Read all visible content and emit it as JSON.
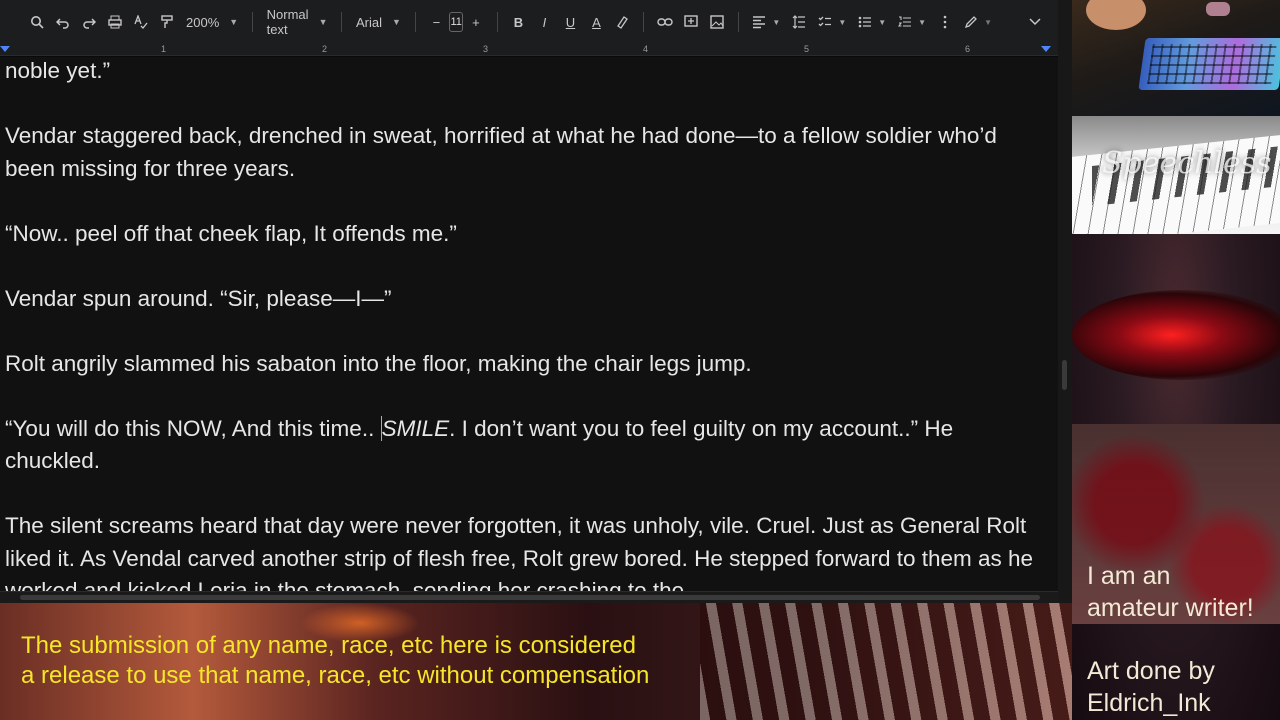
{
  "toolbar": {
    "zoom": "200%",
    "style": "Normal text",
    "font": "Arial",
    "font_size": "11",
    "icons": [
      "search-icon",
      "undo-icon",
      "redo-icon",
      "print-icon",
      "spellcheck-icon",
      "paint-format-icon",
      "bold-icon",
      "italic-icon",
      "underline-icon",
      "text-color-icon",
      "highlight-icon",
      "link-icon",
      "comment-icon",
      "image-icon",
      "align-icon",
      "line-spacing-icon",
      "checklist-icon",
      "bullet-list-icon",
      "numbered-list-icon",
      "more-icon",
      "edit-mode-icon",
      "collapse-icon"
    ],
    "bold_label": "B",
    "italic_label": "I",
    "underline_label": "U",
    "text_color_label": "A"
  },
  "ruler": {
    "ticks": [
      "1",
      "2",
      "3",
      "4",
      "5",
      "6"
    ]
  },
  "document": {
    "p0": "noble yet.”",
    "p1": "Vendar staggered back, drenched in sweat, horrified at what he had done—to a fellow soldier who’d been missing for three years.",
    "p2": "“Now.. peel off that cheek flap, It offends me.”",
    "p3": "Vendar spun around. “Sir, please—I—”",
    "p4": "Rolt angrily slammed his sabaton into the floor, making the chair legs jump.",
    "p5_a": "“You will do this NOW, And this time.. ",
    "p5_em": "SMILE",
    "p5_b": ". I don’t want you to feel guilty on my account..” He chuckled.",
    "p6": "The silent screams heard that day were never forgotten, it was unholy, vile. Cruel. Just as General Rolt liked it. As Vendal carved another strip of flesh free, Rolt grew bored. He stepped forward to them as he worked and kicked Loria in the stomach, sending her crashing to the"
  },
  "piano_overlay": "Speechless",
  "side_text": {
    "line1": "I am an",
    "line2": "amateur writer!",
    "line3": "Art done by",
    "line4": "Eldrich_Ink"
  },
  "banner": {
    "line1": "The submission of any name, race, etc here is considered",
    "line2": "a release to use that name, race, etc without compensation"
  }
}
